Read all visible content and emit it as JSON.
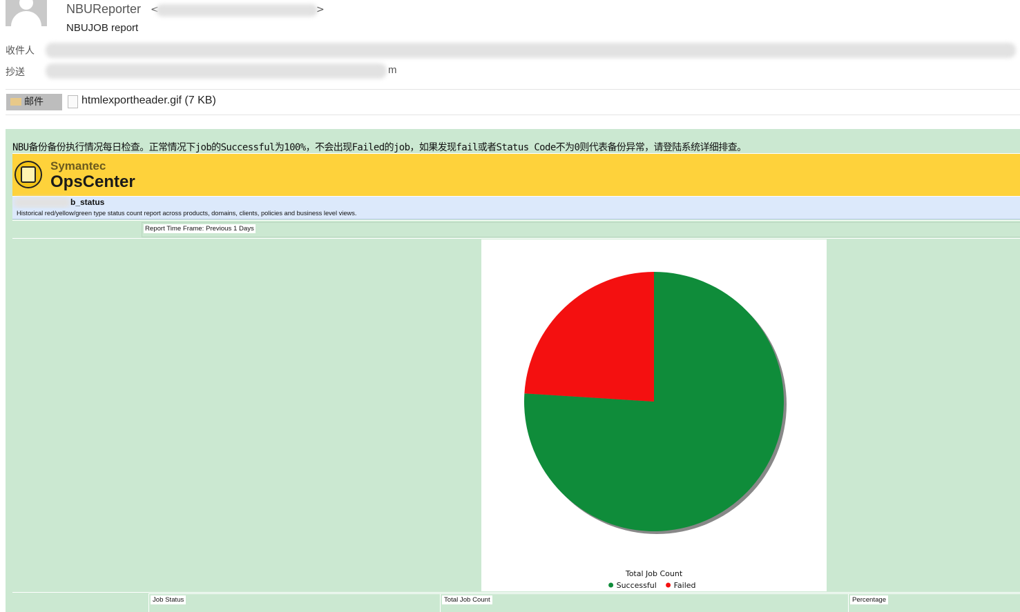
{
  "email": {
    "sender_name": "NBUReporter",
    "sender_open": "<",
    "sender_close": ">",
    "subject": "NBUJOB report",
    "to_label": "收件人",
    "cc_label": "抄送",
    "cc_visible_tail": "m",
    "mail_tab_label": "邮件",
    "attachment": "htmlexportheader.gif (7 KB)"
  },
  "body": {
    "intro": "NBU备份备份执行情况每日检查。正常情况下job的Successful为100%，不会出现Failed的job，如果发现fail或者Status Code不为0则代表备份异常，请登陆系统详细排查。"
  },
  "banner": {
    "brand_line1": "Symantec",
    "brand_line2": "OpsCenter"
  },
  "report": {
    "title_visible": "b_status",
    "description": "Historical red/yellow/green type status count report across products, domains, clients, policies and business level views.",
    "time_frame": "Report Time Frame: Previous 1 Days",
    "table_headers": [
      "Job Status",
      "Total Job Count",
      "Percentage"
    ]
  },
  "chart_data": {
    "type": "pie",
    "title": "Total Job Count",
    "legend_position": "bottom",
    "slices": [
      {
        "label": "Successful",
        "value": 76,
        "color": "#0f8c3a"
      },
      {
        "label": "Failed",
        "value": 24,
        "color": "#f41010"
      }
    ]
  }
}
